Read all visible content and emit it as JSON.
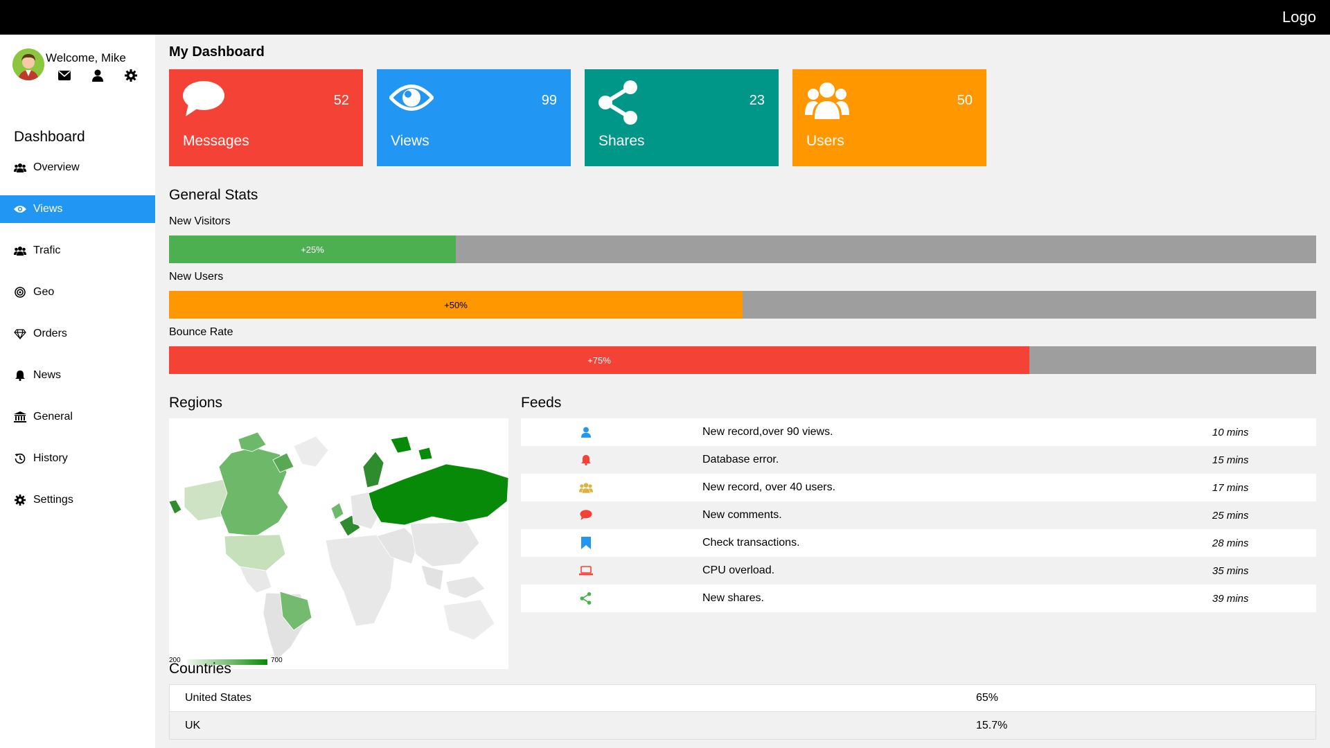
{
  "app": {
    "logo": "Logo"
  },
  "user": {
    "welcome": "Welcome, Mike",
    "icons": [
      "envelope-icon",
      "user-icon",
      "gear-icon"
    ]
  },
  "sidebar": {
    "title": "Dashboard",
    "items": [
      {
        "label": "Overview",
        "icon": "users-icon",
        "active": false
      },
      {
        "label": "Views",
        "icon": "eye-icon",
        "active": true
      },
      {
        "label": "Trafic",
        "icon": "users-icon",
        "active": false
      },
      {
        "label": "Geo",
        "icon": "target-icon",
        "active": false
      },
      {
        "label": "Orders",
        "icon": "diamond-icon",
        "active": false
      },
      {
        "label": "News",
        "icon": "bell-icon",
        "active": false
      },
      {
        "label": "General",
        "icon": "bank-icon",
        "active": false
      },
      {
        "label": "History",
        "icon": "history-icon",
        "active": false
      },
      {
        "label": "Settings",
        "icon": "gear-icon",
        "active": false
      }
    ]
  },
  "dashboard": {
    "title": "My Dashboard",
    "cards": [
      {
        "label": "Messages",
        "value": "52",
        "color": "#f44336",
        "icon": "comment-icon"
      },
      {
        "label": "Views",
        "value": "99",
        "color": "#2196f3",
        "icon": "eye-icon"
      },
      {
        "label": "Shares",
        "value": "23",
        "color": "#009688",
        "icon": "share-icon"
      },
      {
        "label": "Users",
        "value": "50",
        "color": "#ff9800",
        "icon": "users-icon"
      }
    ]
  },
  "stats": {
    "title": "General Stats",
    "bars": [
      {
        "label": "New Visitors",
        "text": "+25%",
        "value": 0.25,
        "color": "#4caf50",
        "text_color": "#ffffff"
      },
      {
        "label": "New Users",
        "text": "+50%",
        "value": 0.5,
        "color": "#ff9800",
        "text_color": "#000000"
      },
      {
        "label": "Bounce Rate",
        "text": "+75%",
        "value": 0.75,
        "color": "#f44336",
        "text_color": "#ffffff"
      }
    ]
  },
  "regions": {
    "title": "Regions",
    "legend_min": "200",
    "legend_max": "700"
  },
  "feeds": {
    "title": "Feeds",
    "items": [
      {
        "icon": "user-icon",
        "color": "#2196f3",
        "text": "New record,over 90 views.",
        "time": "10 mins"
      },
      {
        "icon": "bell-icon",
        "color": "#f44336",
        "text": "Database error.",
        "time": "15 mins"
      },
      {
        "icon": "users-icon",
        "color": "#e0b040",
        "text": "New record, over 40 users.",
        "time": "17 mins"
      },
      {
        "icon": "comment-icon",
        "color": "#f44336",
        "text": "New comments.",
        "time": "25 mins"
      },
      {
        "icon": "bookmark-icon",
        "color": "#2196f3",
        "text": "Check transactions.",
        "time": "28 mins"
      },
      {
        "icon": "laptop-icon",
        "color": "#f44336",
        "text": "CPU overload.",
        "time": "35 mins"
      },
      {
        "icon": "share-icon",
        "color": "#4caf50",
        "text": "New shares.",
        "time": "39 mins"
      }
    ]
  },
  "countries": {
    "title": "Countries",
    "rows": [
      {
        "name": "United States",
        "value": "65%"
      },
      {
        "name": "UK",
        "value": "15.7%"
      }
    ]
  }
}
